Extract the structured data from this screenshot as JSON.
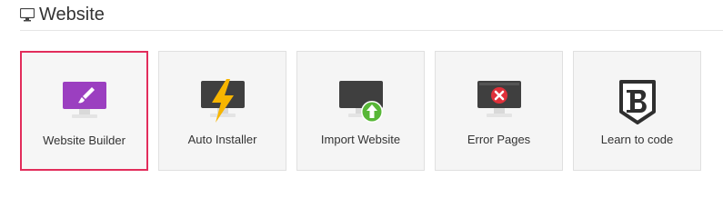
{
  "section": {
    "title": "Website",
    "icon": "monitor-icon"
  },
  "tiles": [
    {
      "label": "Website Builder",
      "icon": "monitor-brush-icon",
      "selected": true
    },
    {
      "label": "Auto Installer",
      "icon": "monitor-lightning-icon",
      "selected": false
    },
    {
      "label": "Import Website",
      "icon": "monitor-upload-icon",
      "selected": false
    },
    {
      "label": "Error Pages",
      "icon": "monitor-error-icon",
      "selected": false
    },
    {
      "label": "Learn to code",
      "icon": "bootstrap-shield-icon",
      "selected": false
    }
  ],
  "colors": {
    "selected_border": "#e22d5b",
    "builder_purple": "#9b3fc0",
    "lightning_yellow": "#f7b500",
    "upload_green": "#58b738",
    "error_red": "#e0303a",
    "dark_screen": "#3f3f3f"
  }
}
